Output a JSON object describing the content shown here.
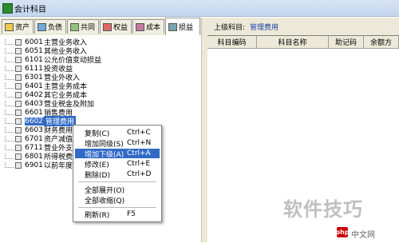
{
  "window": {
    "title": "会计科目"
  },
  "tabs": [
    {
      "label": "资产",
      "icon": "asset-icon"
    },
    {
      "label": "负债",
      "icon": "liability-icon"
    },
    {
      "label": "共同",
      "icon": "common-icon"
    },
    {
      "label": "权益",
      "icon": "equity-icon"
    },
    {
      "label": "成本",
      "icon": "cost-icon"
    },
    {
      "label": "损益",
      "icon": "profit-loss-icon",
      "active": true
    }
  ],
  "tree": [
    {
      "code": "6001",
      "name": "主营业务收入"
    },
    {
      "code": "6051",
      "name": "其他业务收入"
    },
    {
      "code": "6101",
      "name": "公允价值变动损益"
    },
    {
      "code": "6111",
      "name": "投资收益"
    },
    {
      "code": "6301",
      "name": "营业外收入"
    },
    {
      "code": "6401",
      "name": "主营业务成本"
    },
    {
      "code": "6402",
      "name": "其它业务成本"
    },
    {
      "code": "6403",
      "name": "营业税金及附加"
    },
    {
      "code": "6601",
      "name": "销售费用"
    },
    {
      "code": "6602",
      "name": "管理费用",
      "selected": true
    },
    {
      "code": "6603",
      "name": "财务费用"
    },
    {
      "code": "6701",
      "name": "资产减值"
    },
    {
      "code": "6711",
      "name": "营业外支"
    },
    {
      "code": "6801",
      "name": "所得税费"
    },
    {
      "code": "6901",
      "name": "以前年度"
    }
  ],
  "detail": {
    "parent_label": "上级科目:",
    "parent_value": "管理费用",
    "columns": [
      "科目编码",
      "科目名称",
      "助记码",
      "余额方"
    ]
  },
  "context_menu": [
    {
      "label": "复制(C)",
      "shortcut": "Ctrl+C"
    },
    {
      "label": "增加同级(S)",
      "shortcut": "Ctrl+N"
    },
    {
      "label": "增加下级(A)",
      "shortcut": "Ctrl+A",
      "highlighted": true
    },
    {
      "label": "修改(E)",
      "shortcut": "Ctrl+E"
    },
    {
      "label": "删除(D)",
      "shortcut": "Ctrl+D"
    },
    {
      "label": "全部展开(O)",
      "shortcut": ""
    },
    {
      "label": "全部收缩(Q)",
      "shortcut": ""
    },
    {
      "label": "刷新(R)",
      "shortcut": "F5"
    }
  ],
  "watermark": {
    "text": "软件技巧",
    "site": "中文网",
    "logo": "php"
  },
  "colors": {
    "selection": "#316ac5",
    "link": "#1c3fa8"
  }
}
